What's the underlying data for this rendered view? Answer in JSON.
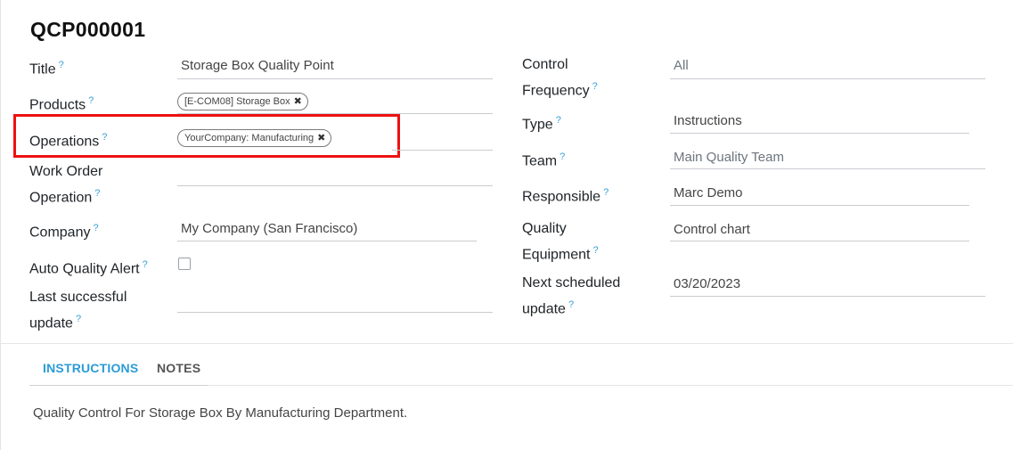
{
  "record": {
    "title": "QCP000001"
  },
  "left_fields": {
    "title": {
      "label": "Title",
      "help": "?",
      "value": "Storage Box Quality Point"
    },
    "products": {
      "label": "Products",
      "help": "?",
      "tag": "[E-COM08] Storage Box",
      "tag_remove": "✖"
    },
    "operations": {
      "label": "Operations",
      "help": "?",
      "tag": "YourCompany: Manufacturing",
      "tag_remove": "✖"
    },
    "work_order_operation": {
      "label_line1": "Work Order",
      "label_line2": "Operation",
      "help": "?",
      "value": ""
    },
    "company": {
      "label": "Company",
      "help": "?",
      "value": "My Company (San Francisco)"
    },
    "auto_quality_alert": {
      "label": "Auto Quality Alert",
      "help": "?",
      "checked": false
    },
    "last_successful_update": {
      "label_line1": "Last successful",
      "label_line2": "update",
      "help": "?",
      "value": ""
    }
  },
  "right_fields": {
    "control_frequency": {
      "label_line1": "Control",
      "label_line2": "Frequency",
      "help": "?",
      "value": "All"
    },
    "type": {
      "label": "Type",
      "help": "?",
      "value": "Instructions"
    },
    "team": {
      "label": "Team",
      "help": "?",
      "value": "Main Quality Team"
    },
    "responsible": {
      "label": "Responsible",
      "help": "?",
      "value": "Marc Demo"
    },
    "quality_equipment": {
      "label_line1": "Quality",
      "label_line2": "Equipment",
      "help": "?",
      "value": "Control chart"
    },
    "next_scheduled_update": {
      "label_line1": "Next scheduled",
      "label_line2": "update",
      "help": "?",
      "value": "03/20/2023"
    }
  },
  "tabs": [
    {
      "label": "INSTRUCTIONS",
      "active": true
    },
    {
      "label": "NOTES",
      "active": false
    }
  ],
  "instructions_text": "Quality Control For Storage Box By Manufacturing Department.",
  "colors": {
    "accent": "#2b9bd6",
    "highlight": "#ee1111",
    "help": "#3aa0d8"
  }
}
